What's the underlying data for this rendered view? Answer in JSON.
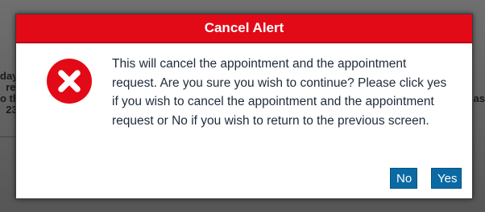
{
  "background": {
    "left_text": "day\n  re\no th\n  23",
    "right_text": "as"
  },
  "dialog": {
    "title": "Cancel Alert",
    "icon": "error-x-icon",
    "message": "This will cancel the appointment and the appointment request. Are you sure you wish to continue? Please click yes if you wish to cancel the appointment and the appointment request or No if you wish to return to the previous screen.",
    "buttons": {
      "no_label": "No",
      "yes_label": "Yes"
    },
    "colors": {
      "header": "#e30a17",
      "icon": "#e30a17",
      "button": "#0b6aa3",
      "text": "#1f2b3a"
    }
  }
}
